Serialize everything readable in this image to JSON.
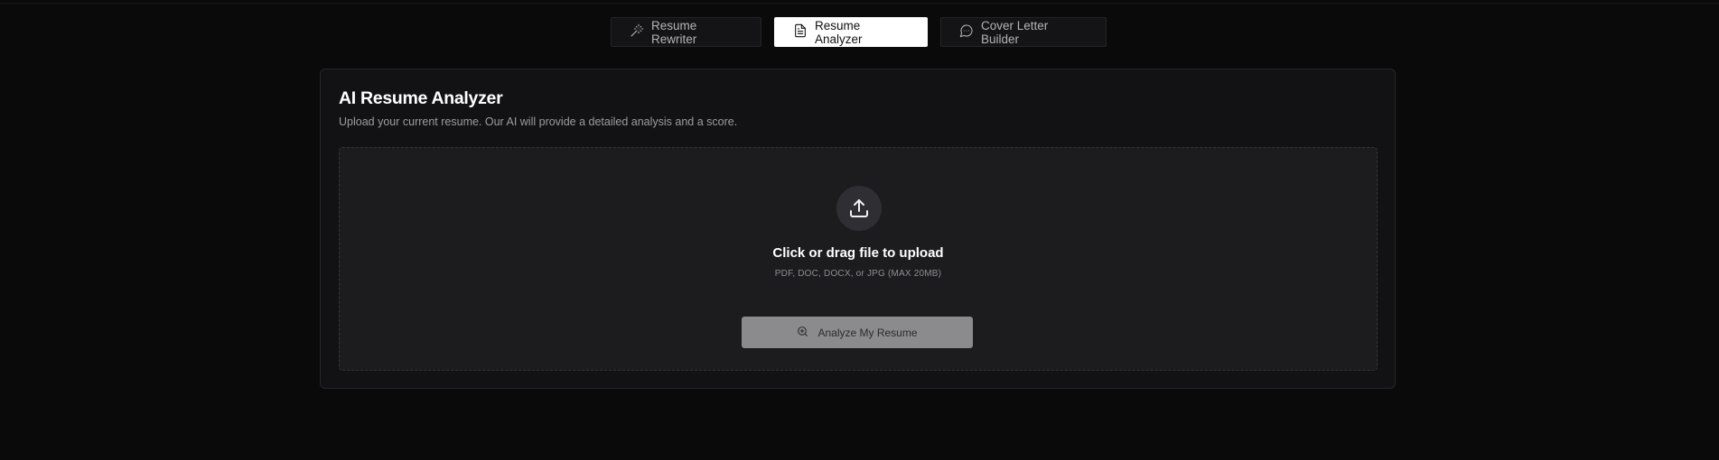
{
  "tabs": [
    {
      "label": "Resume Rewriter",
      "icon": "magic-wand-icon",
      "active": false
    },
    {
      "label": "Resume Analyzer",
      "icon": "document-icon",
      "active": true
    },
    {
      "label": "Cover Letter Builder",
      "icon": "chat-bubble-icon",
      "active": false
    }
  ],
  "card": {
    "title": "AI Resume Analyzer",
    "subtitle": "Upload your current resume. Our AI will provide a detailed analysis and a score."
  },
  "upload": {
    "icon": "upload-icon",
    "title": "Click or drag file to upload",
    "hint": "PDF, DOC, DOCX, or JPG (MAX 20MB)"
  },
  "analyze_button": {
    "label": "Analyze My Resume",
    "icon": "search-icon",
    "disabled": true
  },
  "colors": {
    "background": "#0a0a0b",
    "card": "#121214",
    "active_tab": "#ffffff",
    "button_disabled": "#8b8b8e"
  }
}
